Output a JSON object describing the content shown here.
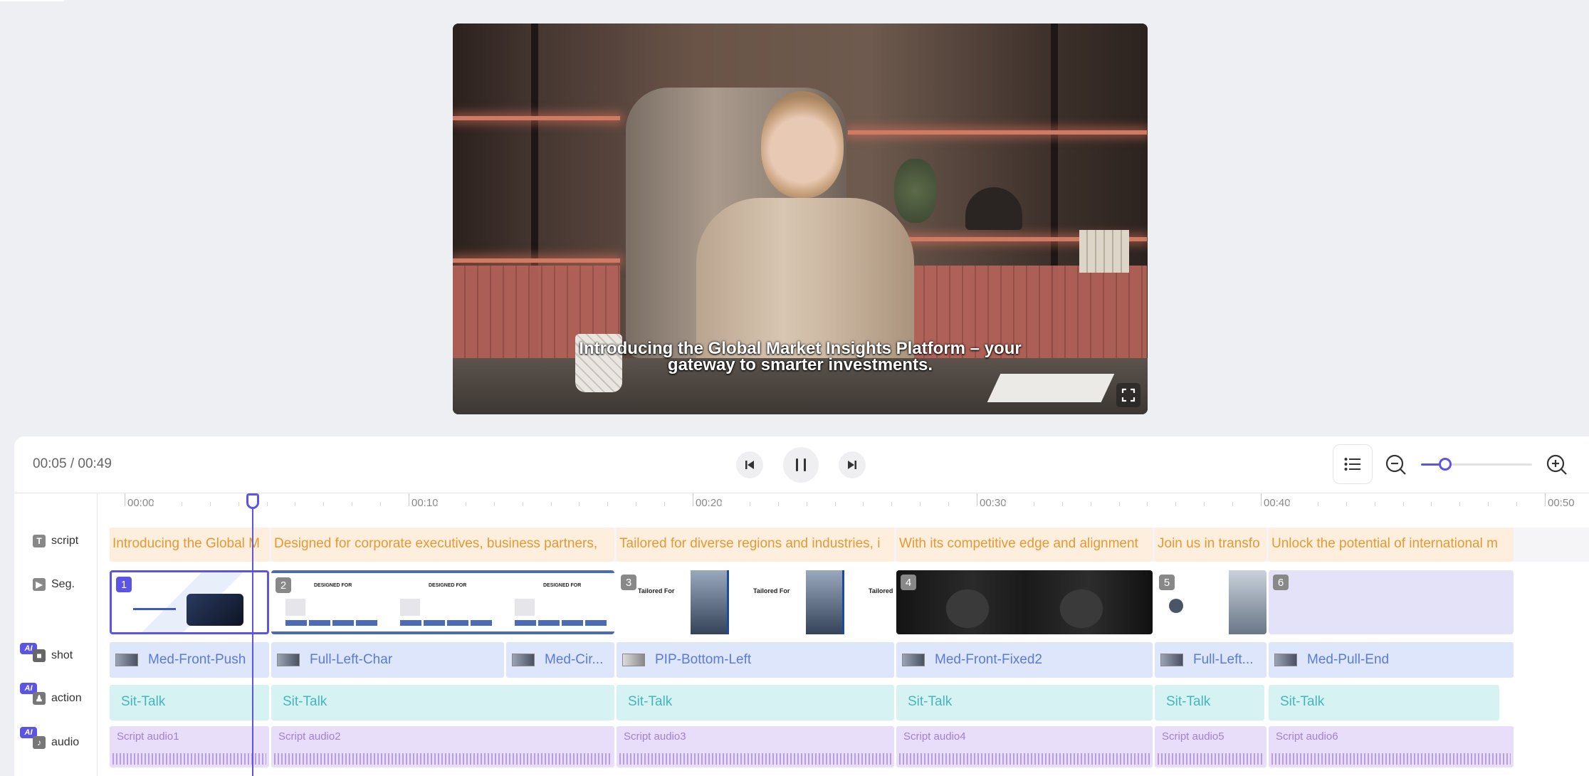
{
  "player": {
    "subtitle_line1": "Introducing the Global Market Insights Platform – your",
    "subtitle_line2": "gateway to smarter investments.",
    "time_display": "00:05 / 00:49"
  },
  "ruler": {
    "labels": [
      "00:00",
      "00:10",
      "00:20",
      "00:30",
      "00:40",
      "00:50"
    ]
  },
  "tracks": {
    "script": "script",
    "seg": "Seg.",
    "shot": "shot",
    "action": "action",
    "audio": "audio",
    "ai_badge": "AI"
  },
  "script_clips": [
    "Introducing the Global M",
    "Designed for corporate executives, business partners,",
    "Tailored for diverse regions and industries, i",
    "With its competitive edge and alignment",
    "Join us in transfo",
    "Unlock the potential of international m"
  ],
  "segments": [
    "1",
    "2",
    "3",
    "4",
    "5",
    "6"
  ],
  "segment_texts": {
    "designed_for": "DESIGNED FOR",
    "tailored_for": "Tailored For",
    "tailored_for_cut": "Tailored"
  },
  "shot_clips": [
    "Med-Front-Push",
    "Full-Left-Char",
    "Med-Cir...",
    "PIP-Bottom-Left",
    "Med-Front-Fixed2",
    "Full-Left...",
    "Med-Pull-End"
  ],
  "action_clips": [
    "Sit-Talk",
    "Sit-Talk",
    "Sit-Talk",
    "Sit-Talk",
    "Sit-Talk",
    "Sit-Talk"
  ],
  "audio_clips": [
    "Script audio1",
    "Script audio2",
    "Script audio3",
    "Script audio4",
    "Script audio5",
    "Script audio6"
  ],
  "zoom": {
    "level": 0.22
  },
  "colors": {
    "accent": "#5b55e6",
    "script": "#e39a33",
    "shot": "#5b7bd6",
    "action": "#45b6c0",
    "audio": "#a27fd8"
  }
}
